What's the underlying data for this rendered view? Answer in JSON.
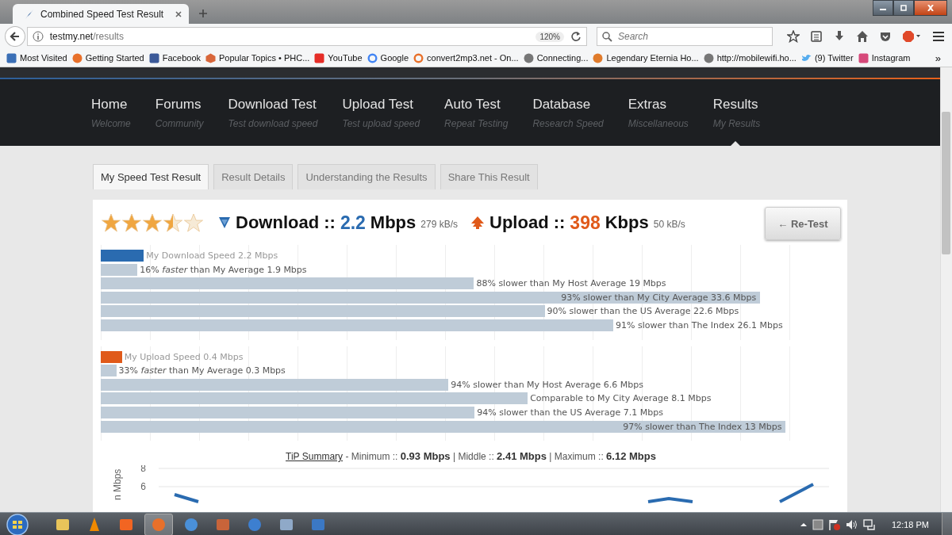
{
  "browser": {
    "tab_title": "Combined Speed Test Result",
    "url_domain": "testmy.net",
    "url_path": "/results",
    "zoom": "120%",
    "search_placeholder": "Search",
    "bookmarks": [
      "Most Visited",
      "Getting Started",
      "Facebook",
      "Popular Topics • PHC...",
      "YouTube",
      "Google",
      "convert2mp3.net - On...",
      "Connecting...",
      "Legendary Eternia Ho...",
      "http://mobilewifi.ho...",
      "(9) Twitter",
      "Instagram"
    ],
    "bookmarks_more": "»"
  },
  "site_nav": [
    {
      "title": "Home",
      "subtitle": "Welcome",
      "selected": false
    },
    {
      "title": "Forums",
      "subtitle": "Community",
      "selected": false
    },
    {
      "title": "Download Test",
      "subtitle": "Test download speed",
      "selected": false
    },
    {
      "title": "Upload Test",
      "subtitle": "Test upload speed",
      "selected": false
    },
    {
      "title": "Auto Test",
      "subtitle": "Repeat Testing",
      "selected": false
    },
    {
      "title": "Database",
      "subtitle": "Research Speed",
      "selected": false
    },
    {
      "title": "Extras",
      "subtitle": "Miscellaneous",
      "selected": false
    },
    {
      "title": "Results",
      "subtitle": "My Results",
      "selected": true
    }
  ],
  "tabs": [
    {
      "label": "My Speed Test Result",
      "selected": true
    },
    {
      "label": "Result Details",
      "selected": false
    },
    {
      "label": "Understanding the Results",
      "selected": false
    },
    {
      "label": "Share This Result",
      "selected": false
    }
  ],
  "result": {
    "stars": 3.5,
    "download": {
      "label": "Download ::",
      "value": "2.2",
      "unit": "Mbps",
      "rate": "279 kB/s"
    },
    "upload": {
      "label": "Upload ::",
      "value": "398",
      "unit": "Kbps",
      "rate": "50 kB/s"
    },
    "retest": "← Re-Test"
  },
  "download_bars": [
    {
      "kind": "own",
      "label": "My Download Speed 2.2 Mbps",
      "level": 0.061,
      "color": "#2a6bb0"
    },
    {
      "kind": "compare",
      "label": "16% *faster* than My Average 1.9 Mbps",
      "level": 0.052,
      "color": "#bfccd8"
    },
    {
      "kind": "compare",
      "label": "88% slower than My Host Average 19 Mbps",
      "level": 0.528,
      "color": "#bfccd8"
    },
    {
      "kind": "compare-end",
      "label": "93% slower than My City Average 33.6 Mbps",
      "level": 0.933,
      "color": "#bfccd8"
    },
    {
      "kind": "compare",
      "label": "90% slower than the US Average 22.6 Mbps",
      "level": 0.628,
      "color": "#bfccd8"
    },
    {
      "kind": "compare",
      "label": "91% slower than The Index 26.1 Mbps",
      "level": 0.725,
      "color": "#bfccd8"
    }
  ],
  "upload_bars": [
    {
      "kind": "own",
      "label": "My Upload Speed 0.4 Mbps",
      "level": 0.03,
      "color": "#e05a1a"
    },
    {
      "kind": "compare",
      "label": "33% *faster* than My Average 0.3 Mbps",
      "level": 0.022,
      "color": "#bfccd8"
    },
    {
      "kind": "compare",
      "label": "94% slower than My Host Average 6.6 Mbps",
      "level": 0.492,
      "color": "#bfccd8"
    },
    {
      "kind": "compare",
      "label": "Comparable to My City Average 8.1 Mbps",
      "level": 0.604,
      "color": "#bfccd8"
    },
    {
      "kind": "compare",
      "label": "94% slower than the US Average 7.1 Mbps",
      "level": 0.529,
      "color": "#bfccd8"
    },
    {
      "kind": "compare-end",
      "label": "97% slower than The Index 13 Mbps",
      "level": 0.969,
      "color": "#bfccd8"
    }
  ],
  "summary": {
    "link": "TiP Summary",
    "text": "- Minimum :: **0.93 Mbps** | Middle :: **2.41 Mbps** | Maximum :: **6.12 Mbps**"
  },
  "tip_chart": {
    "ylabel": "n Mbps",
    "yticks": [
      "8",
      "6"
    ]
  },
  "taskbar": {
    "clock": "12:18 PM"
  }
}
